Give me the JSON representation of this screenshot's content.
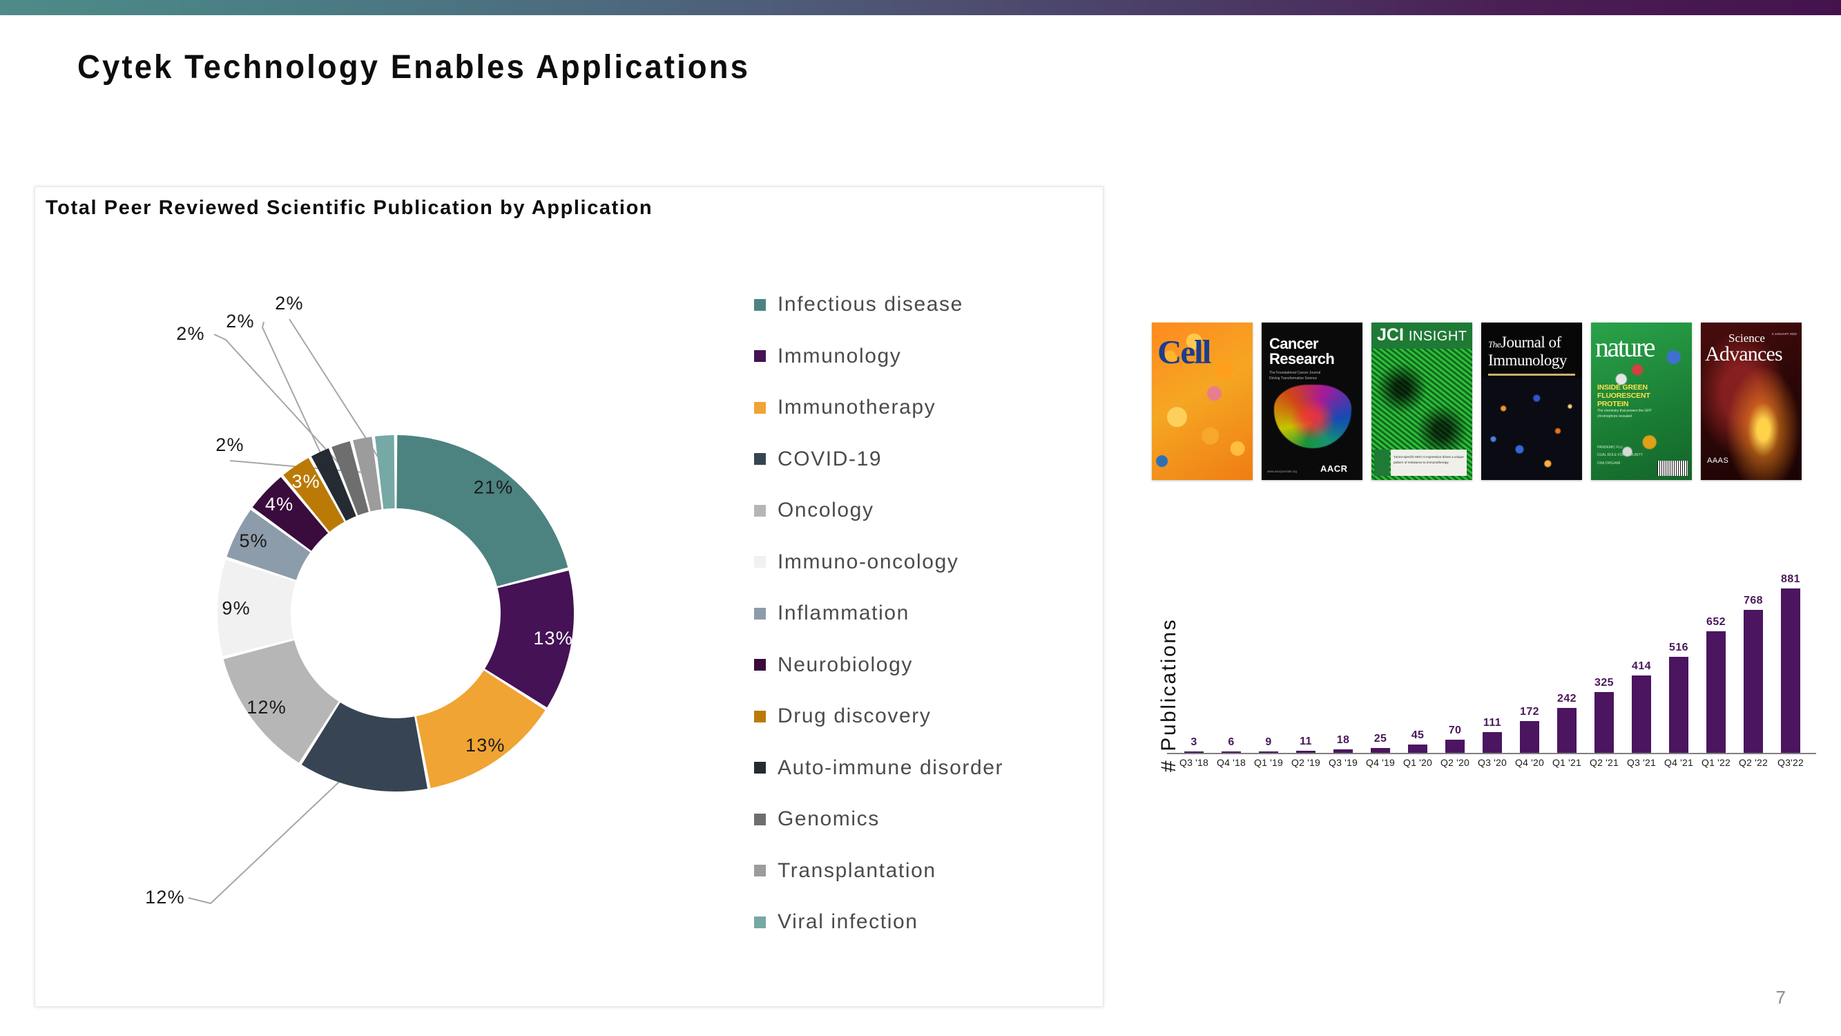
{
  "slide": {
    "title": "Cytek Technology Enables Applications",
    "number": "7",
    "topbar_gradient_from": "#4e8b88",
    "topbar_gradient_to": "#44134d"
  },
  "pie_card": {
    "title": "Total Peer Reviewed Scientific Publication by Application"
  },
  "legend": {
    "items": [
      {
        "label": "Infectious disease",
        "color": "#4c8380"
      },
      {
        "label": "Immunology",
        "color": "#441255"
      },
      {
        "label": "Immunotherapy",
        "color": "#f0a434"
      },
      {
        "label": "COVID-19",
        "color": "#374453"
      },
      {
        "label": "Oncology",
        "color": "#b6b6b6"
      },
      {
        "label": "Immuno-oncology",
        "color": "#f1f1f1"
      },
      {
        "label": "Inflammation",
        "color": "#8d9caa"
      },
      {
        "label": "Neurobiology",
        "color": "#3a0b3d"
      },
      {
        "label": "Drug discovery",
        "color": "#bb7a06"
      },
      {
        "label": "Auto-immune disorder",
        "color": "#242b33"
      },
      {
        "label": "Genomics",
        "color": "#6e6e6e"
      },
      {
        "label": "Transplantation",
        "color": "#9c9c9c"
      },
      {
        "label": "Viral infection",
        "color": "#76a8a5"
      }
    ]
  },
  "covers": {
    "items": [
      {
        "name": "Cell",
        "title": "Cell"
      },
      {
        "name": "Cancer Research",
        "title_line1": "Cancer",
        "title_line2": "Research",
        "subtitle": "The Foundational Cancer Journal Driving Transformative Science",
        "footer": "AACR",
        "footer2": "www.aacrjournals.org"
      },
      {
        "name": "JCI Insight",
        "title_main": "JCI",
        "title_sub": "INSIGHT",
        "caption": "Tumor-specific MHC-II expression drives a unique pattern of resistance to immunotherapy"
      },
      {
        "name": "The Journal of Immunology",
        "title_pre": "The",
        "title_line1": "Journal of",
        "title_line2": "Immunology"
      },
      {
        "name": "Nature",
        "title": "nature",
        "kicker1": "INSIDE GREEN",
        "kicker2": "FLUORESCENT",
        "kicker3": "PROTEIN",
        "kicker_sub": "The chemistry that powers the GFP chromophore revealed",
        "low1": "PANDEMIC FLU",
        "low2": "DUAL ROLE FOR IMMUNITY",
        "low3": "DNA ORIGAMI"
      },
      {
        "name": "Science Advances",
        "title_line1": "Science",
        "title_line2": "Advances",
        "date": "5 JANUARY 2022",
        "publisher": "AAAS"
      }
    ]
  },
  "chart_data": [
    {
      "type": "pie",
      "variant": "donut",
      "title": "Total Peer Reviewed Scientific Publication by Application",
      "unit": "%",
      "legend_position": "right",
      "start_angle_deg": 0,
      "direction": "clockwise",
      "labels": [
        "Infectious disease",
        "Immunology",
        "Immunotherapy",
        "COVID-19",
        "Oncology",
        "Immuno-oncology",
        "Inflammation",
        "Neurobiology",
        "Drug discovery",
        "Auto-immune disorder",
        "Genomics",
        "Transplantation",
        "Viral infection"
      ],
      "values": [
        21,
        13,
        13,
        12,
        12,
        9,
        5,
        4,
        3,
        2,
        2,
        2,
        2
      ],
      "value_labels": [
        "21%",
        "13%",
        "13%",
        "12%",
        "12%",
        "9%",
        "5%",
        "4%",
        "3%",
        "2%",
        "2%",
        "2%",
        "2%"
      ],
      "colors": [
        "#4c8380",
        "#441255",
        "#f0a434",
        "#374453",
        "#b6b6b6",
        "#f1f1f1",
        "#8d9caa",
        "#3a0b3d",
        "#bb7a06",
        "#242b33",
        "#6e6e6e",
        "#9c9c9c",
        "#76a8a5"
      ],
      "label_text_colors": [
        "#1a1a1a",
        "#ffffff",
        "#1a1a1a",
        "#ffffff",
        "#1a1a1a",
        "#1a1a1a",
        "#1a1a1a",
        "#ffffff",
        "#ffffff",
        "#ffffff",
        "#1a1a1a",
        "#1a1a1a",
        "#1a1a1a"
      ],
      "leader_line_slices": [
        "COVID-19",
        "Auto-immune disorder",
        "Genomics",
        "Transplantation",
        "Viral infection"
      ]
    },
    {
      "type": "bar",
      "title": "",
      "xlabel": "",
      "ylabel": "# Publications",
      "ylim": [
        0,
        881
      ],
      "grid": false,
      "bar_color": "#4b1560",
      "label_color": "#4a1858",
      "categories": [
        "Q3 '18",
        "Q4 '18",
        "Q1 '19",
        "Q2 '19",
        "Q3 '19",
        "Q4 '19",
        "Q1 '20",
        "Q2 '20",
        "Q3 '20",
        "Q4 '20",
        "Q1 '21",
        "Q2 '21",
        "Q3 '21",
        "Q4 '21",
        "Q1 '22",
        "Q2 '22",
        "Q3'22"
      ],
      "values": [
        3,
        6,
        9,
        11,
        18,
        25,
        45,
        70,
        111,
        172,
        242,
        325,
        414,
        516,
        652,
        768,
        881
      ]
    }
  ]
}
